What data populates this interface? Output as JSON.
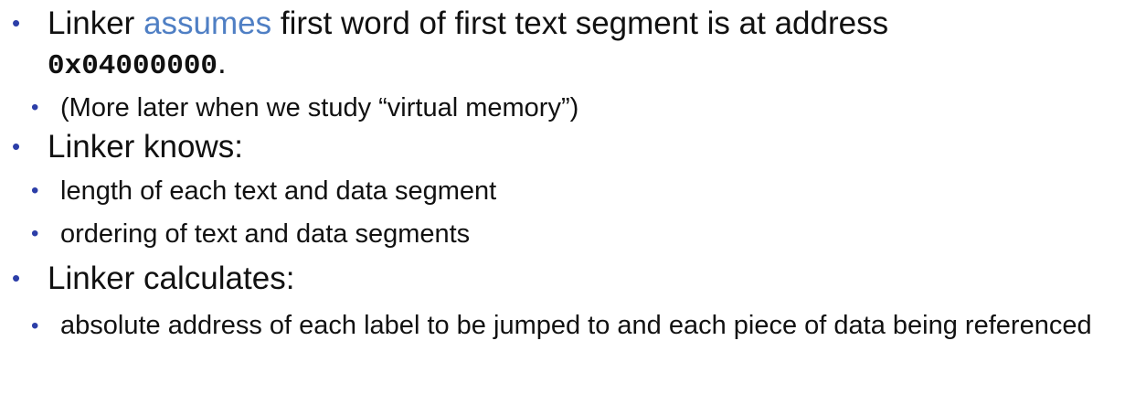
{
  "bullets": [
    {
      "pre": "Linker ",
      "highlight": "assumes",
      "post": " first word of first text segment is at address",
      "code": "0x04000000",
      "code_suffix": ".",
      "sub": [
        "(More later when we study “virtual memory”)"
      ]
    },
    {
      "text": "Linker knows:",
      "sub": [
        "length of each text and data segment",
        "ordering of text and data segments"
      ]
    },
    {
      "text": "Linker calculates:",
      "sub": [
        "absolute address of each label to be jumped to and each piece of data being referenced"
      ]
    }
  ],
  "colors": {
    "bullet": "#2c3ea8",
    "highlight": "#4f7fc4",
    "text": "#111111"
  }
}
